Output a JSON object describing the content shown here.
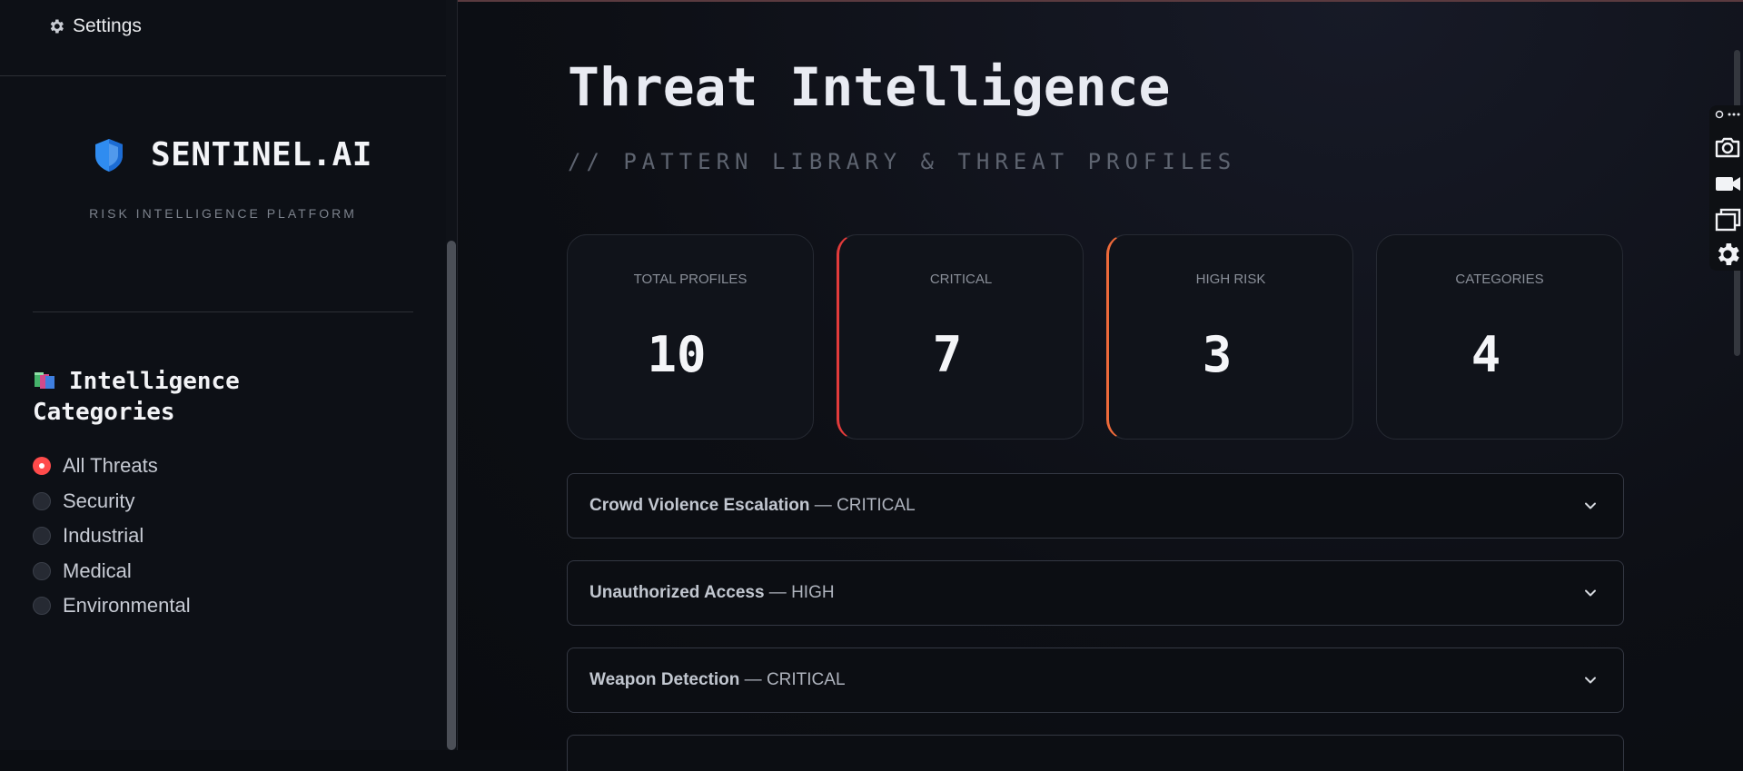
{
  "sidebar": {
    "settings_label": "Settings",
    "brand_name": "SENTINEL.AI",
    "brand_tagline": "RISK INTELLIGENCE PLATFORM",
    "categories_heading": "Intelligence Categories",
    "categories": [
      {
        "label": "All Threats",
        "selected": true
      },
      {
        "label": "Security",
        "selected": false
      },
      {
        "label": "Industrial",
        "selected": false
      },
      {
        "label": "Medical",
        "selected": false
      },
      {
        "label": "Environmental",
        "selected": false
      }
    ]
  },
  "main": {
    "title": "Threat Intelligence",
    "subtitle": "// PATTERN LIBRARY & THREAT PROFILES",
    "metrics": [
      {
        "label": "TOTAL PROFILES",
        "value": "10"
      },
      {
        "label": "CRITICAL",
        "value": "7"
      },
      {
        "label": "HIGH RISK",
        "value": "3"
      },
      {
        "label": "CATEGORIES",
        "value": "4"
      }
    ],
    "profiles": [
      {
        "name": "Crowd Violence Escalation",
        "level": "— CRITICAL"
      },
      {
        "name": "Unauthorized Access",
        "level": "— HIGH"
      },
      {
        "name": "Weapon Detection",
        "level": "— CRITICAL"
      }
    ]
  },
  "colors": {
    "accent_selected": "#ff4b4b",
    "critical": "#e23b3b",
    "high": "#ee6a3a"
  },
  "icons": [
    "gear-icon",
    "shield-icon",
    "books-icon",
    "chevron-down-icon",
    "camera-icon",
    "video-icon",
    "gallery-icon",
    "gear-icon"
  ]
}
